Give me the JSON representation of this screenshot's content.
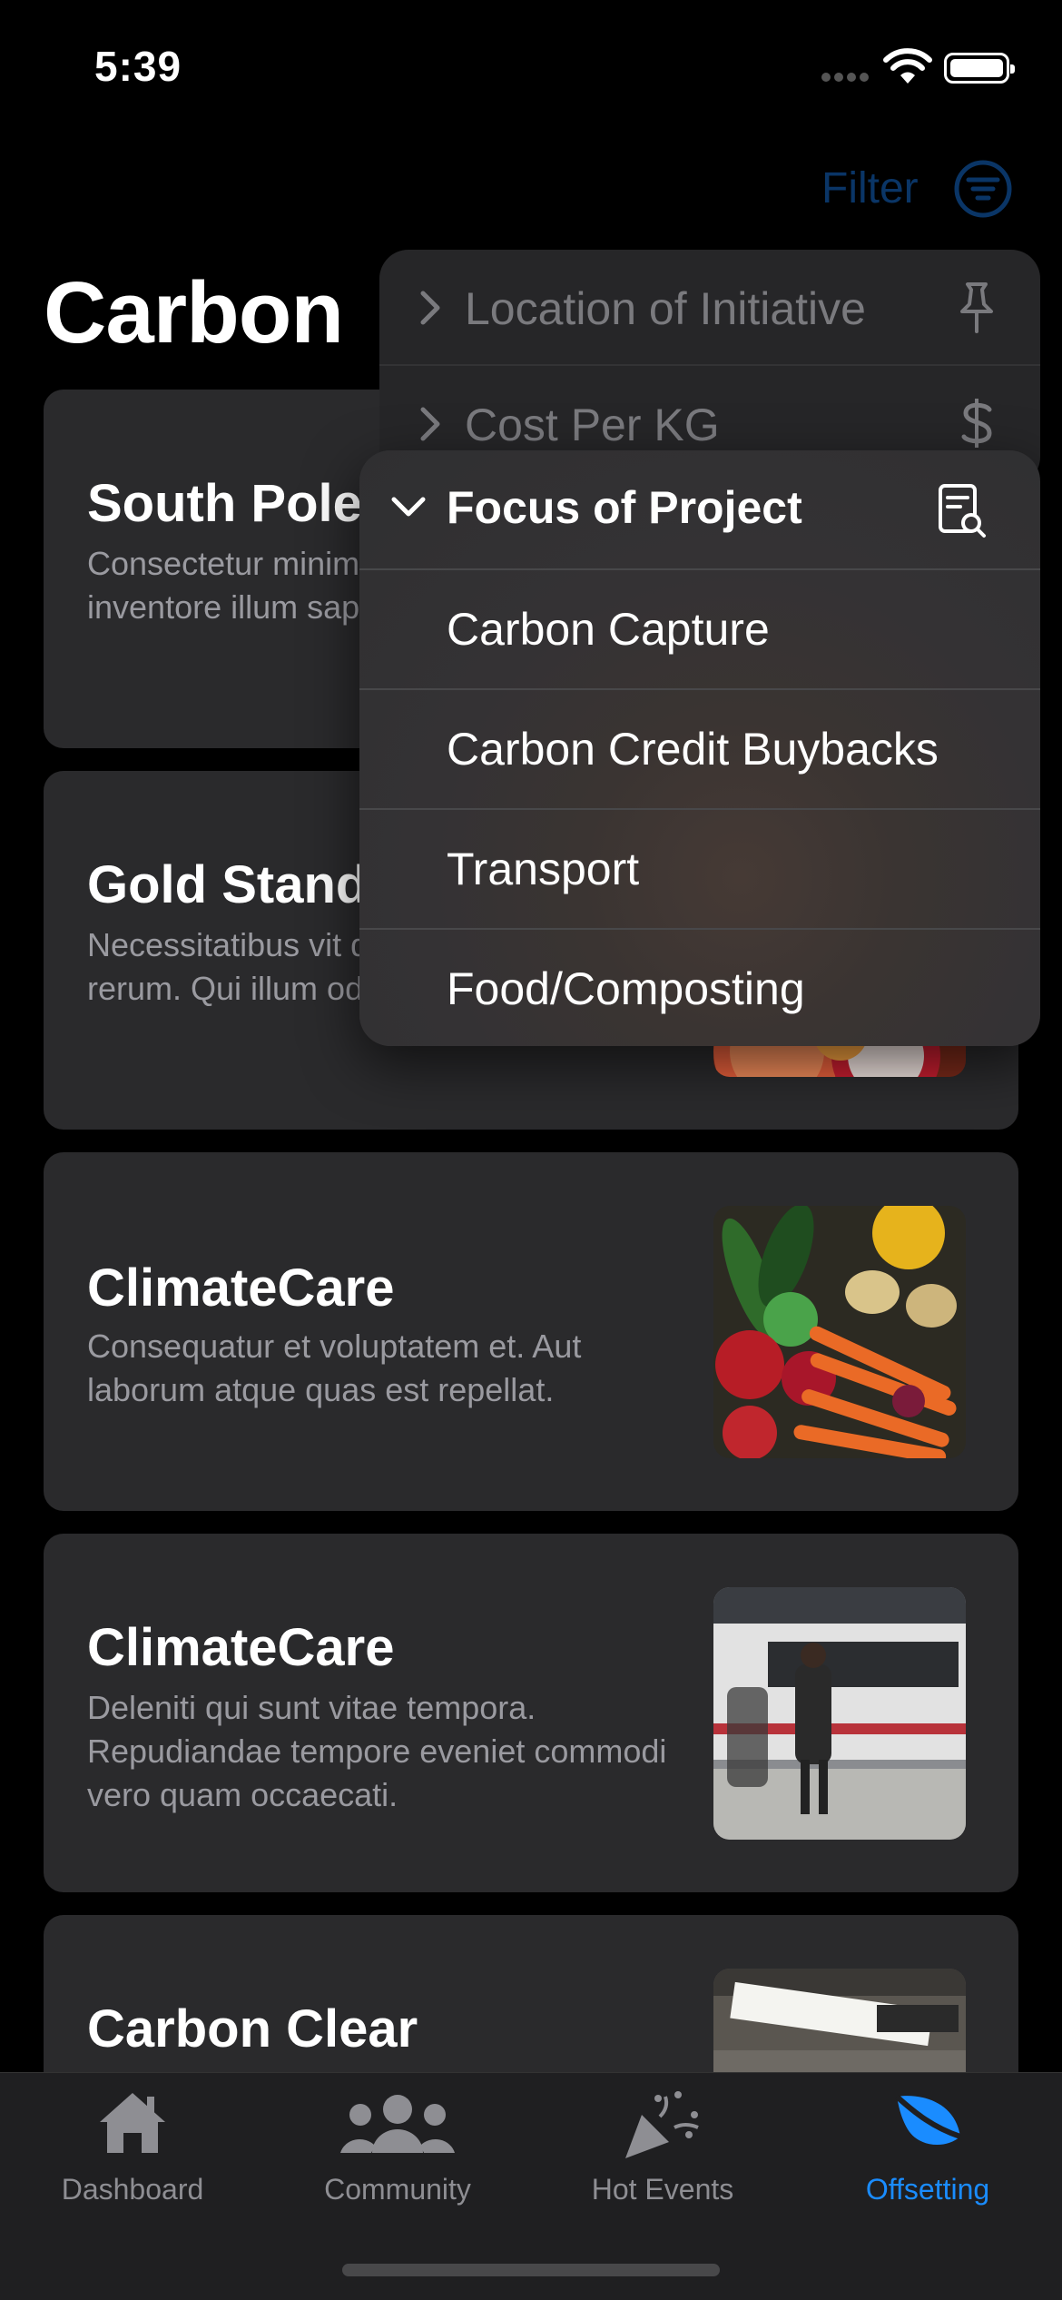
{
  "status_bar": {
    "time": "5:39"
  },
  "header": {
    "filter_label": "Filter",
    "title": "Carbon"
  },
  "cards": [
    {
      "title": "South Pole",
      "description": "Consectetur minim ducimus voluptate inventore illum sap",
      "thumbnail": "none"
    },
    {
      "title": "Gold Stand",
      "description": "Necessitatibus vit deleniti dolores ve rerum. Qui illum od",
      "thumbnail": "fruit-slices"
    },
    {
      "title": "ClimateCare",
      "description": "Consequatur et voluptatem et. Aut laborum atque quas est repellat.",
      "thumbnail": "vegetables"
    },
    {
      "title": "ClimateCare",
      "description": "Deleniti qui sunt vitae tempora. Repudiandae tempore eveniet commodi vero quam occaecati.",
      "thumbnail": "train-station"
    },
    {
      "title": "Carbon Clear",
      "description": "",
      "thumbnail": "subway-platform"
    }
  ],
  "filter_menu_back": [
    {
      "label": "Location of Initiative",
      "icon": "pin-icon"
    },
    {
      "label": "Cost Per KG",
      "icon": "dollar-icon"
    }
  ],
  "filter_menu_front": {
    "header": {
      "label": "Focus of Project",
      "icon": "document-search-icon"
    },
    "items": [
      {
        "label": "Carbon Capture"
      },
      {
        "label": "Carbon Credit Buybacks"
      },
      {
        "label": "Transport"
      },
      {
        "label": "Food/Composting"
      }
    ]
  },
  "tab_bar": {
    "items": [
      {
        "label": "Dashboard",
        "icon": "house-icon",
        "active": false
      },
      {
        "label": "Community",
        "icon": "people-icon",
        "active": false
      },
      {
        "label": "Hot Events",
        "icon": "party-popper-icon",
        "active": false
      },
      {
        "label": "Offsetting",
        "icon": "leaf-icon",
        "active": true
      }
    ]
  },
  "colors": {
    "accent": "#1A8CFF",
    "filter_dim": "#0A3566",
    "card_bg": "#2A2A2C",
    "background": "#000000"
  }
}
